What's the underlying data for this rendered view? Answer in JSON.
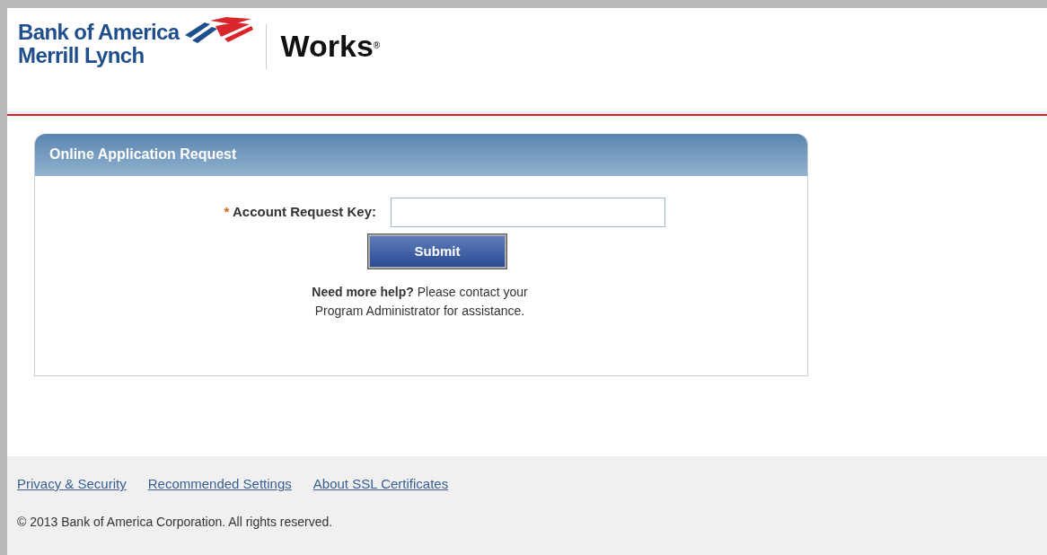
{
  "header": {
    "logo_lines": [
      "Bank of America",
      "Merrill Lynch"
    ],
    "product": "Works",
    "product_mark": "®"
  },
  "panel": {
    "title": "Online Application Request",
    "field": {
      "label": "Account Request Key:",
      "required_mark": "*",
      "required": true
    },
    "button": "Submit",
    "help": "**Need more help?**  Please contact your\nProgram Administrator for assistance."
  },
  "footer": {
    "links": [
      "Privacy & Security",
      "Recommended Settings",
      "About SSL Certificates"
    ],
    "copyright": "© 2013 Bank of America Corporation. All rights reserved."
  }
}
